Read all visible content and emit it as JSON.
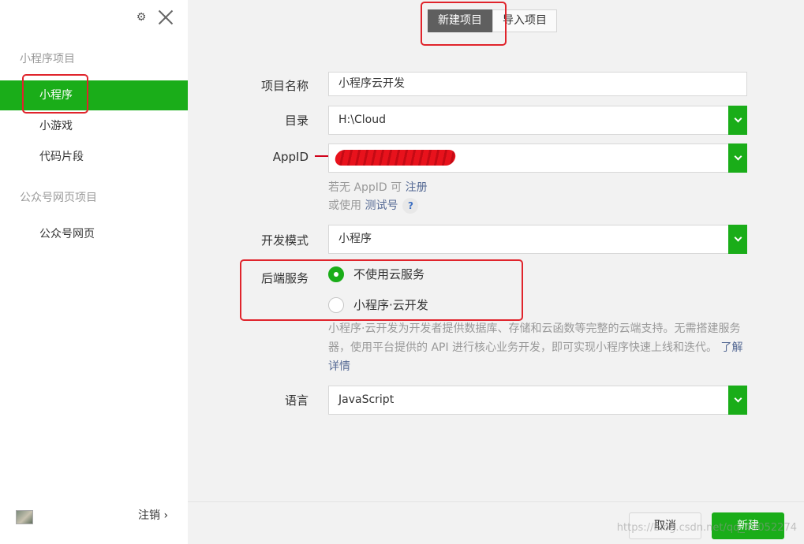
{
  "sidebar": {
    "section_mini": "小程序项目",
    "items_mini": [
      {
        "label": "小程序"
      },
      {
        "label": "小游戏"
      },
      {
        "label": "代码片段"
      }
    ],
    "section_web": "公众号网页项目",
    "items_web": [
      {
        "label": "公众号网页"
      }
    ],
    "logout_label": "注销 ›"
  },
  "tabs": {
    "new_project": "新建项目",
    "import_project": "导入项目"
  },
  "form": {
    "name_label": "项目名称",
    "name_value": "小程序云开发",
    "dir_label": "目录",
    "dir_value": "H:\\Cloud",
    "appid_label": "AppID",
    "appid_hint_prefix": "若无 AppID 可 ",
    "appid_hint_link": "注册",
    "test_hint_prefix": "或使用 ",
    "test_hint_link": "测试号",
    "help_mark": "?",
    "mode_label": "开发模式",
    "mode_value": "小程序",
    "backend_label": "后端服务",
    "backend_option_1": "不使用云服务",
    "backend_option_2": "小程序·云开发",
    "backend_selected": "不使用云服务",
    "desc_text": "小程序·云开发为开发者提供数据库、存储和云函数等完整的云端支持。无需搭建服务器，使用平台提供的 API 进行核心业务开发，即可实现小程序快速上线和迭代。",
    "desc_link": "了解详情",
    "lang_label": "语言",
    "lang_value": "JavaScript"
  },
  "buttons": {
    "cancel": "取消",
    "create": "新建"
  },
  "watermark": "https://blog.csdn.net/qq_43052274",
  "colors": {
    "accent": "#1aad19",
    "annotation": "#e0242c"
  }
}
